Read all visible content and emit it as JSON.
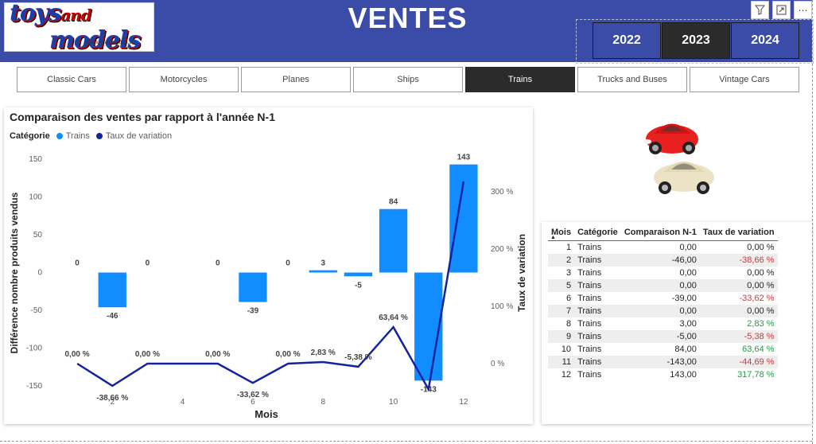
{
  "header": {
    "title": "VENTES",
    "logo_word1": "toys",
    "logo_word2": "and",
    "logo_word3": "models",
    "logo_url": "www.toysandmodels.pl",
    "years": [
      "2022",
      "2023",
      "2024"
    ],
    "selected_year": "2023"
  },
  "categories": [
    "Classic Cars",
    "Motorcycles",
    "Planes",
    "Ships",
    "Trains",
    "Trucks and Buses",
    "Vintage Cars"
  ],
  "selected_category": "Trains",
  "chart": {
    "title": "Comparaison des ventes par rapport à l'année N-1",
    "legend_label": "Catégorie",
    "legend_series1": "Trains",
    "legend_series2": "Taux de variation",
    "xlabel": "Mois",
    "ylabel": "Différence nombre produits vendus",
    "y2label": "Taux de variation"
  },
  "chart_data": {
    "type": "bar",
    "x": [
      1,
      2,
      3,
      4,
      5,
      6,
      7,
      8,
      9,
      10,
      11,
      12
    ],
    "series": [
      {
        "name": "Trains",
        "type": "bar",
        "values": [
          0,
          -46,
          0,
          null,
          0,
          -39,
          0,
          3,
          -5,
          84,
          -143,
          143
        ],
        "labels": [
          "0",
          "-46",
          "0",
          "",
          "0",
          "-39",
          "0",
          "3",
          "-5",
          "84",
          "-143",
          "143"
        ]
      },
      {
        "name": "Taux de variation",
        "type": "line",
        "axis": "secondary",
        "values": [
          0,
          -38.66,
          0,
          0,
          0,
          -33.62,
          0,
          2.83,
          -5.38,
          63.64,
          -44.69,
          317.78
        ],
        "labels": [
          "0,00 %",
          "-38,66 %",
          "0,00 %",
          "",
          "0,00 %",
          "-33,62 %",
          "0,00 %",
          "2,83 %",
          "-5,38 %",
          "63,64 %",
          "",
          ""
        ]
      }
    ],
    "xticks": [
      "2",
      "4",
      "6",
      "8",
      "10",
      "12"
    ],
    "xtick_values": [
      2,
      4,
      6,
      8,
      10,
      12
    ],
    "yticks": [
      "150",
      "100",
      "50",
      "0",
      "-50",
      "-100",
      "-150"
    ],
    "ytick_values": [
      150,
      100,
      50,
      0,
      -50,
      -100,
      -150
    ],
    "y2ticks": [
      "300 %",
      "200 %",
      "100 %",
      "0 %"
    ],
    "y2tick_values": [
      300,
      200,
      100,
      0
    ],
    "ylim": [
      -150,
      150
    ],
    "y2lim": [
      -44.69,
      317.78
    ],
    "colors": {
      "bar": "#118dff",
      "line": "#12239e"
    }
  },
  "table": {
    "headers": [
      "Mois",
      "Catégorie",
      "Comparaison N-1",
      "Taux de variation"
    ],
    "rows": [
      {
        "mois": "1",
        "cat": "Trains",
        "comp": "0,00",
        "taux": "0,00 %",
        "sign": "zero"
      },
      {
        "mois": "2",
        "cat": "Trains",
        "comp": "-46,00",
        "taux": "-38,66 %",
        "sign": "neg"
      },
      {
        "mois": "3",
        "cat": "Trains",
        "comp": "0,00",
        "taux": "0,00 %",
        "sign": "zero"
      },
      {
        "mois": "5",
        "cat": "Trains",
        "comp": "0,00",
        "taux": "0,00 %",
        "sign": "zero"
      },
      {
        "mois": "6",
        "cat": "Trains",
        "comp": "-39,00",
        "taux": "-33,62 %",
        "sign": "neg"
      },
      {
        "mois": "7",
        "cat": "Trains",
        "comp": "0,00",
        "taux": "0,00 %",
        "sign": "zero"
      },
      {
        "mois": "8",
        "cat": "Trains",
        "comp": "3,00",
        "taux": "2,83 %",
        "sign": "pos"
      },
      {
        "mois": "9",
        "cat": "Trains",
        "comp": "-5,00",
        "taux": "-5,38 %",
        "sign": "neg"
      },
      {
        "mois": "10",
        "cat": "Trains",
        "comp": "84,00",
        "taux": "63,64 %",
        "sign": "pos"
      },
      {
        "mois": "11",
        "cat": "Trains",
        "comp": "-143,00",
        "taux": "-44,69 %",
        "sign": "neg"
      },
      {
        "mois": "12",
        "cat": "Trains",
        "comp": "143,00",
        "taux": "317,78 %",
        "sign": "pos"
      }
    ]
  },
  "icons": [
    "filter-icon",
    "focus-mode-icon",
    "more-options-icon",
    "sort-ascending-icon"
  ]
}
